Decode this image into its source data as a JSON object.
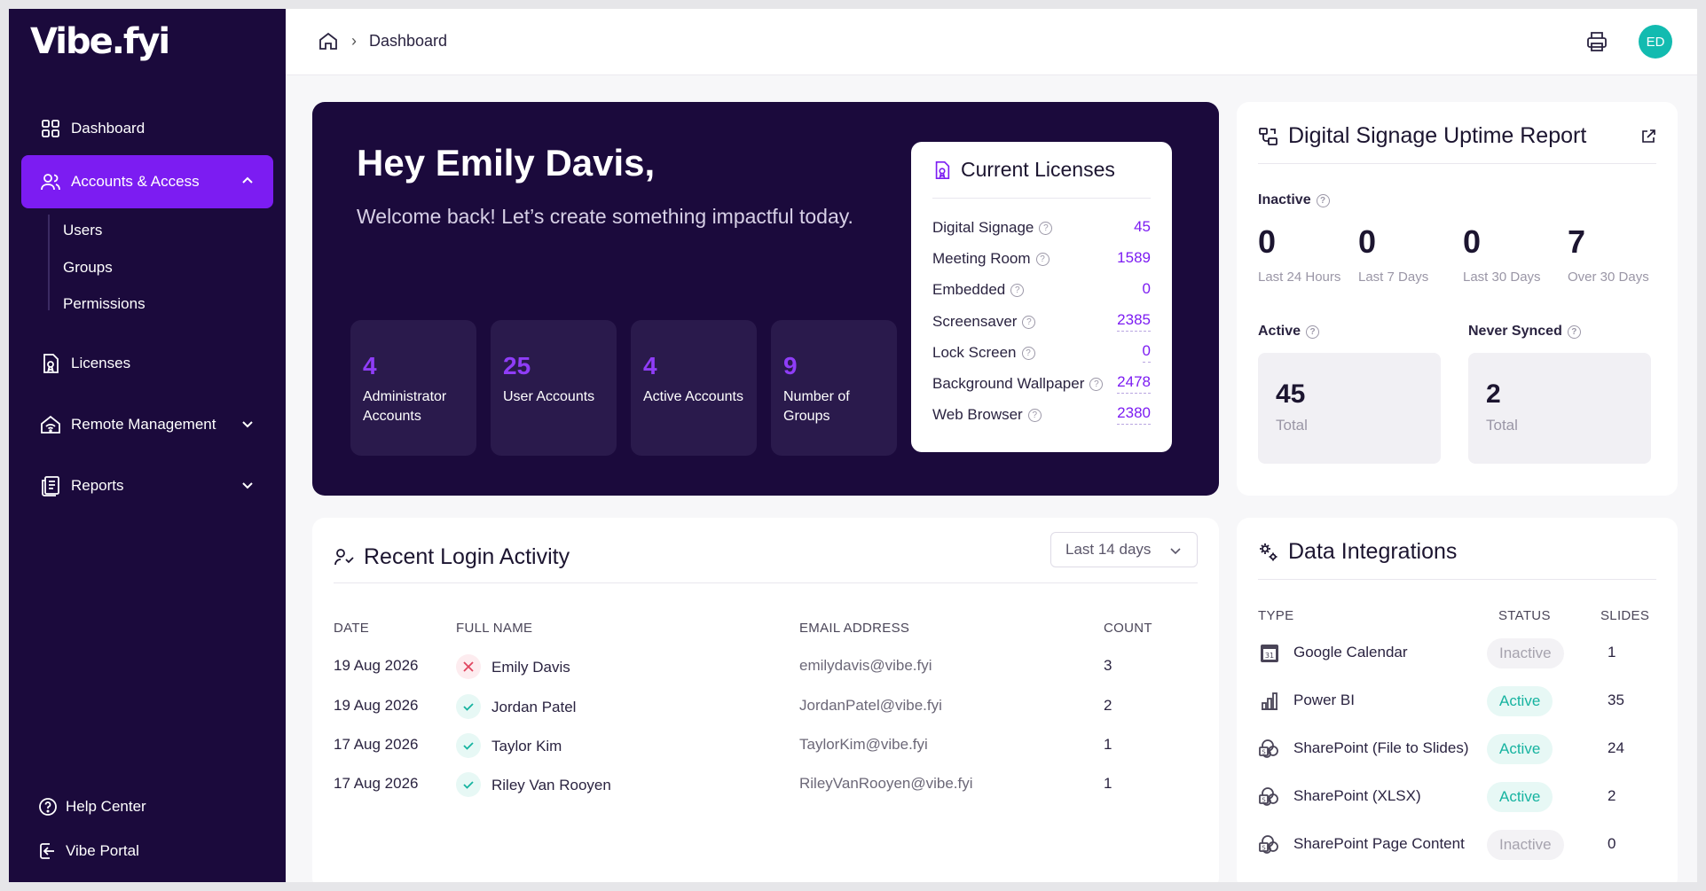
{
  "app": {
    "logo": "Vibe.fyi"
  },
  "sidebar": {
    "items": [
      {
        "label": "Dashboard",
        "icon": "grid-icon"
      },
      {
        "label": "Accounts & Access",
        "icon": "users-icon",
        "expanded": true
      },
      {
        "label": "Licenses",
        "icon": "license-icon"
      },
      {
        "label": "Remote Management",
        "icon": "remote-icon"
      },
      {
        "label": "Reports",
        "icon": "reports-icon"
      }
    ],
    "sub_items": [
      "Users",
      "Groups",
      "Permissions"
    ],
    "bottom": [
      {
        "label": "Help Center",
        "icon": "help-icon"
      },
      {
        "label": "Vibe Portal",
        "icon": "portal-icon"
      }
    ]
  },
  "topbar": {
    "breadcrumb": "Dashboard",
    "avatar": "ED"
  },
  "hero": {
    "title": "Hey Emily Davis,",
    "subtitle": "Welcome back! Let’s create something impactful today.",
    "stats": [
      {
        "value": "4",
        "label": "Administrator Accounts"
      },
      {
        "value": "25",
        "label": "User Accounts"
      },
      {
        "value": "4",
        "label": "Active Accounts"
      },
      {
        "value": "9",
        "label": "Number of Groups"
      }
    ]
  },
  "licenses": {
    "title": "Current Licenses",
    "rows": [
      {
        "label": "Digital Signage",
        "value": "45"
      },
      {
        "label": "Meeting Room",
        "value": "1589"
      },
      {
        "label": "Embedded",
        "value": "0"
      },
      {
        "label": "Screensaver",
        "value": "2385"
      },
      {
        "label": "Lock Screen",
        "value": "0"
      },
      {
        "label": "Background Wallpaper",
        "value": "2478"
      },
      {
        "label": "Web Browser",
        "value": "2380"
      }
    ]
  },
  "uptime": {
    "title": "Digital Signage Uptime Report",
    "inactive_label": "Inactive",
    "inactive": [
      {
        "value": "0",
        "caption": "Last 24 Hours"
      },
      {
        "value": "0",
        "caption": "Last 7 Days"
      },
      {
        "value": "0",
        "caption": "Last 30 Days"
      },
      {
        "value": "7",
        "caption": "Over 30 Days"
      }
    ],
    "active_label": "Active",
    "active_total": "45",
    "never_label": "Never Synced",
    "never_total": "2",
    "total_caption": "Total"
  },
  "logins": {
    "title": "Recent Login Activity",
    "range": "Last 14 days",
    "columns": [
      "DATE",
      "FULL NAME",
      "EMAIL ADDRESS",
      "COUNT"
    ],
    "rows": [
      {
        "date": "19 Aug 2026",
        "name": "Emily Davis",
        "email": "emilydavis@vibe.fyi",
        "count": "3",
        "status": "failed"
      },
      {
        "date": "19 Aug 2026",
        "name": "Jordan Patel",
        "email": "JordanPatel@vibe.fyi",
        "count": "2",
        "status": "success"
      },
      {
        "date": "17 Aug 2026",
        "name": "Taylor Kim",
        "email": "TaylorKim@vibe.fyi",
        "count": "1",
        "status": "success"
      },
      {
        "date": "17 Aug 2026",
        "name": "Riley Van Rooyen",
        "email": "RileyVanRooyen@vibe.fyi",
        "count": "1",
        "status": "success"
      }
    ]
  },
  "integrations": {
    "title": "Data Integrations",
    "columns": [
      "TYPE",
      "STATUS",
      "SLIDES"
    ],
    "rows": [
      {
        "type": "Google Calendar",
        "status": "Inactive",
        "slides": "1",
        "icon": "calendar-icon"
      },
      {
        "type": "Power BI",
        "status": "Active",
        "slides": "35",
        "icon": "chart-icon"
      },
      {
        "type": "SharePoint (File to Slides)",
        "status": "Active",
        "slides": "24",
        "icon": "sharepoint-icon"
      },
      {
        "type": "SharePoint (XLSX)",
        "status": "Active",
        "slides": "2",
        "icon": "sharepoint-icon"
      },
      {
        "type": "SharePoint Page Content",
        "status": "Inactive",
        "slides": "0",
        "icon": "sharepoint-icon"
      }
    ]
  },
  "colors": {
    "sidebar": "#1b0a3c",
    "accent": "#7c1cf2",
    "active": "#16b3a0",
    "avatar": "#12bbb0"
  }
}
